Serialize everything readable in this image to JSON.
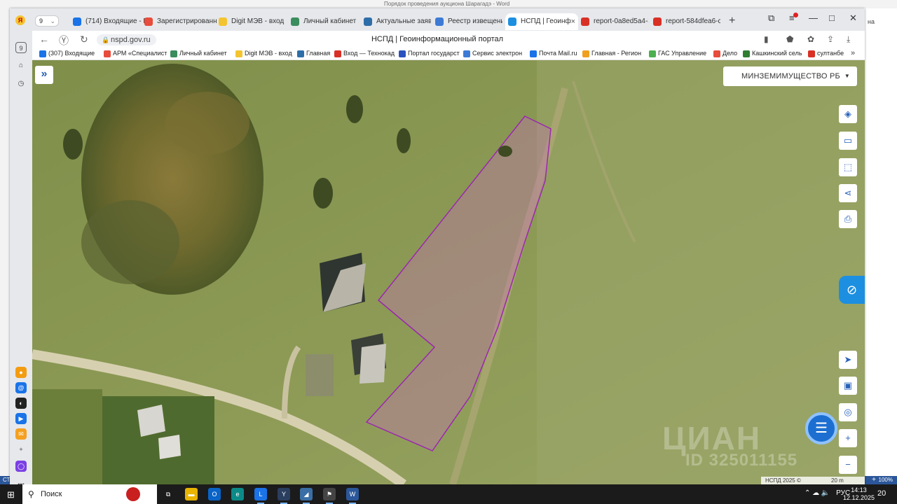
{
  "word": {
    "title": "Порядок проведения аукциона Шарагадэ - Word",
    "right_text": "на",
    "right_mark": "▲",
    "status_left": "СТ",
    "zoom": "100%",
    "zoom_plus": "+"
  },
  "browser": {
    "tab_count": "9",
    "tabs": [
      {
        "label": "(714) Входящие - Г",
        "icon": "mail-icon",
        "color": "#1a73e8"
      },
      {
        "label": "Зарегистрированн",
        "icon": "yandex-icon",
        "color": "#e74c3c"
      },
      {
        "label": "Digit МЭВ - вход",
        "icon": "digit-icon",
        "color": "#f4c430"
      },
      {
        "label": "Личный кабинет",
        "icon": "gosuslugi-icon",
        "color": "#3a8d5c"
      },
      {
        "label": "Актуальные заявл",
        "icon": "doc-icon",
        "color": "#2d6ea8"
      },
      {
        "label": "Реестр извещени",
        "icon": "registry-icon",
        "color": "#3d7ad6"
      },
      {
        "label": "НСПД | Геоинф",
        "icon": "nspd-icon",
        "color": "#1c8fe0",
        "active": true,
        "close": "×"
      },
      {
        "label": "report-0a8ed5a4-3",
        "icon": "pdf-icon",
        "color": "#d93025"
      },
      {
        "label": "report-584dfea6-c",
        "icon": "pdf-icon",
        "color": "#d93025"
      }
    ],
    "new_tab": "+",
    "window_controls": {
      "restore": "⧉",
      "minimize": "—",
      "maximize": "□",
      "close": "✕"
    },
    "url": "nspd.gov.ru",
    "page_title": "НСПД | Геоинформационный портал",
    "bookmarks": [
      {
        "label": "(307) Входящие",
        "color": "#1a73e8"
      },
      {
        "label": "АРМ «Специалист",
        "color": "#e74c3c"
      },
      {
        "label": "Личный кабинет",
        "color": "#3a8d5c"
      },
      {
        "label": "Digit МЭВ - вход",
        "color": "#f4c430"
      },
      {
        "label": "Главная",
        "color": "#2d6ea8"
      },
      {
        "label": "Вход — Технокад",
        "color": "#d93025"
      },
      {
        "label": "Портал государст",
        "color": "#2a52be"
      },
      {
        "label": "Сервис электрон",
        "color": "#3d7ad6"
      },
      {
        "label": "Почта Mail.ru",
        "color": "#1a73e8"
      },
      {
        "label": "Главная - Регион",
        "color": "#f0a020"
      },
      {
        "label": "ГАС Управление",
        "color": "#4caf50"
      },
      {
        "label": "Дело",
        "color": "#e74c3c"
      },
      {
        "label": "Кашкинский сель",
        "color": "#2e7d32"
      },
      {
        "label": "султанбе",
        "color": "#d93025"
      }
    ],
    "bookmarks_more": "»"
  },
  "sidepanel": {
    "items": [
      {
        "label": "9",
        "name": "tabs-counter-icon"
      },
      {
        "label": "⌂",
        "name": "collections-icon"
      },
      {
        "label": "◷",
        "name": "history-icon"
      }
    ],
    "apps": [
      {
        "label": "●",
        "name": "app-cloud-icon",
        "color": "#f39c12"
      },
      {
        "label": "@",
        "name": "app-mail-icon",
        "color": "#1a73e8"
      },
      {
        "label": "◐",
        "name": "app-messenger-icon",
        "color": "#222"
      },
      {
        "label": "▶",
        "name": "app-telemost-icon",
        "color": "#1a73e8"
      },
      {
        "label": "✉",
        "name": "app-post-icon",
        "color": "#f4a020"
      },
      {
        "label": "+",
        "name": "add-app-icon",
        "color": "transparent"
      },
      {
        "label": "◯",
        "name": "alice-icon",
        "color": "#7b3fe4"
      },
      {
        "label": "•••",
        "name": "more-icon",
        "color": "transparent"
      }
    ]
  },
  "map": {
    "layer_selector": "МИНЗЕМИМУЩЕСТВО РБ",
    "expand": "»",
    "tools": [
      {
        "name": "layers-icon",
        "glyph": "◈"
      },
      {
        "name": "ruler-icon",
        "glyph": "▭"
      },
      {
        "name": "select-area-icon",
        "glyph": "⬚"
      },
      {
        "name": "share-icon",
        "glyph": "⋖"
      },
      {
        "name": "print-icon",
        "glyph": "⎙"
      }
    ],
    "bottom_tools": [
      {
        "name": "navigate-icon",
        "glyph": "➤"
      },
      {
        "name": "minimap-icon",
        "glyph": "▣"
      },
      {
        "name": "locate-icon",
        "glyph": "◎"
      },
      {
        "name": "zoom-in-icon",
        "glyph": "+"
      },
      {
        "name": "zoom-out-icon",
        "glyph": "−"
      }
    ],
    "chat_glyph": "☰",
    "side_glyph": "⊘",
    "watermark": "ЦИАН",
    "watermark_id": "ID 325011155",
    "attribution": "НСПД 2025 ©",
    "scale": "20 m"
  },
  "taskbar": {
    "search": "Поиск",
    "lang": "РУС",
    "time": "14:13",
    "date": "12.12.2025",
    "notif_count": "20",
    "tray_icons": "⌃  ☁  🔈",
    "apps": [
      {
        "name": "task-view-icon",
        "glyph": "⧉",
        "color": "transparent"
      },
      {
        "name": "explorer-icon",
        "glyph": "▬",
        "color": "#e8b400"
      },
      {
        "name": "outlook-icon",
        "glyph": "O",
        "color": "#0a64c8"
      },
      {
        "name": "edge-icon",
        "glyph": "e",
        "color": "#0c8a88"
      },
      {
        "name": "lync-icon",
        "glyph": "L",
        "color": "#1a73e8"
      },
      {
        "name": "yandex-browser-icon",
        "glyph": "Y",
        "color": "#2a3e5f"
      },
      {
        "name": "scanner-icon",
        "glyph": "◢",
        "color": "#3a6ea5"
      },
      {
        "name": "docs-icon",
        "glyph": "⚑",
        "color": "#444"
      },
      {
        "name": "word-icon",
        "glyph": "W",
        "color": "#2b579a"
      }
    ]
  }
}
